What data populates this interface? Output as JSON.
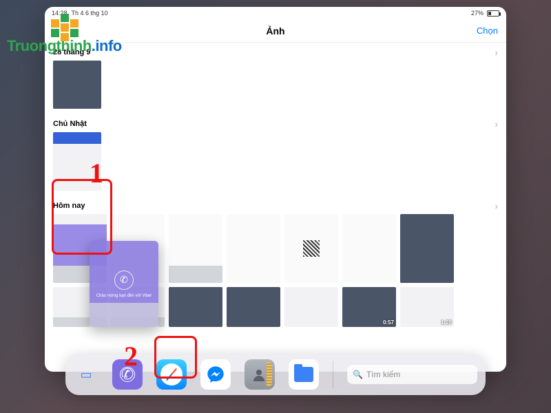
{
  "status": {
    "time": "14:28",
    "date": "Th 4 6 thg 10",
    "battery_percent": "27%"
  },
  "nav": {
    "title": "Ảnh",
    "action": "Chọn"
  },
  "sections": {
    "s1": "28 tháng 9",
    "s2": "Chủ Nhật",
    "s3": "Hôm nay"
  },
  "videos": {
    "d1": "0:57",
    "d2": "1:28"
  },
  "dragged": {
    "caption": "Chào mừng bạn đến với Viber"
  },
  "dock": {
    "search_placeholder": "Tìm kiếm"
  },
  "annotations": {
    "n1": "1",
    "n2": "2"
  },
  "watermark": {
    "part1": "Truongthinh",
    "part2": ".info"
  }
}
